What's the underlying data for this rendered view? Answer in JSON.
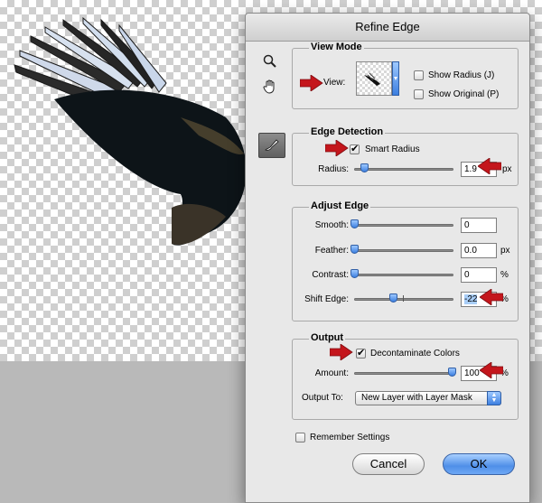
{
  "dialog": {
    "title": "Refine Edge"
  },
  "tools": {
    "zoom_icon": "zoom-icon",
    "hand_icon": "hand-icon",
    "refine_radius_icon": "refine-radius-brush-icon"
  },
  "view_mode": {
    "title": "View Mode",
    "view_label": "View:",
    "show_radius_label": "Show Radius (J)",
    "show_radius_checked": false,
    "show_original_label": "Show Original (P)",
    "show_original_checked": false
  },
  "edge_detection": {
    "title": "Edge Detection",
    "smart_radius_label": "Smart Radius",
    "smart_radius_checked": true,
    "radius_label": "Radius:",
    "radius_value": "1.9",
    "radius_unit": "px",
    "radius_slider_fraction": 0.02
  },
  "adjust_edge": {
    "title": "Adjust Edge",
    "smooth_label": "Smooth:",
    "smooth_value": "0",
    "smooth_slider_fraction": 0.0,
    "feather_label": "Feather:",
    "feather_value": "0.0",
    "feather_unit": "px",
    "feather_slider_fraction": 0.0,
    "contrast_label": "Contrast:",
    "contrast_value": "0",
    "contrast_unit": "%",
    "contrast_slider_fraction": 0.0,
    "shift_edge_label": "Shift Edge:",
    "shift_edge_value": "-22",
    "shift_edge_unit": "%",
    "shift_edge_slider_fraction": 0.39
  },
  "output": {
    "title": "Output",
    "decontaminate_label": "Decontaminate Colors",
    "decontaminate_checked": true,
    "amount_label": "Amount:",
    "amount_value": "100",
    "amount_unit": "%",
    "amount_slider_fraction": 1.0,
    "output_to_label": "Output To:",
    "output_to_value": "New Layer with Layer Mask"
  },
  "remember_settings_label": "Remember Settings",
  "remember_settings_checked": false,
  "buttons": {
    "cancel": "Cancel",
    "ok": "OK"
  },
  "colors": {
    "annotation_arrow": "#c4161c",
    "slider_thumb": "#3c7fe0",
    "ok_button": "#4f8fe8"
  }
}
